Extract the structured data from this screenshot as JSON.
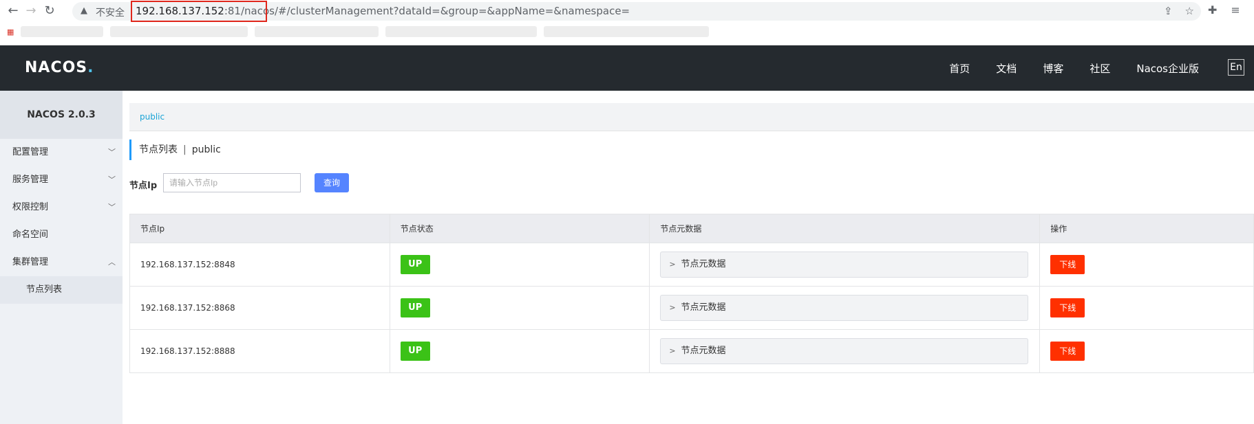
{
  "browser": {
    "back_icon": "←",
    "forward_icon": "→",
    "reload_icon": "↻",
    "insecure_label": "不安全",
    "url_host": "192.168.137.152",
    "url_port_path": ":81/nacos/",
    "url_rest": "#/clusterManagement?dataId=&group=&appName=&namespace="
  },
  "header": {
    "logo": "NACOS",
    "logo_dot": ".",
    "nav": [
      "首页",
      "文档",
      "博客",
      "社区",
      "Nacos企业版"
    ],
    "lang": "En"
  },
  "sidebar": {
    "title": "NACOS 2.0.3",
    "items": [
      {
        "label": "配置管理",
        "chev": "﹀"
      },
      {
        "label": "服务管理",
        "chev": "﹀"
      },
      {
        "label": "权限控制",
        "chev": "﹀"
      },
      {
        "label": "命名空间",
        "chev": ""
      },
      {
        "label": "集群管理",
        "chev": "︿"
      }
    ],
    "sub_item": "节点列表"
  },
  "main": {
    "namespace": "public",
    "title": "节点列表",
    "title_sep": "|",
    "title_ns": "public",
    "search_label": "节点Ip",
    "search_placeholder": "请输入节点Ip",
    "search_button": "查询",
    "columns": [
      "节点Ip",
      "节点状态",
      "节点元数据",
      "操作"
    ],
    "rows": [
      {
        "ip": "192.168.137.152:8848",
        "status": "UP",
        "meta": "节点元数据",
        "action": "下线"
      },
      {
        "ip": "192.168.137.152:8868",
        "status": "UP",
        "meta": "节点元数据",
        "action": "下线"
      },
      {
        "ip": "192.168.137.152:8888",
        "status": "UP",
        "meta": "节点元数据",
        "action": "下线"
      }
    ]
  }
}
